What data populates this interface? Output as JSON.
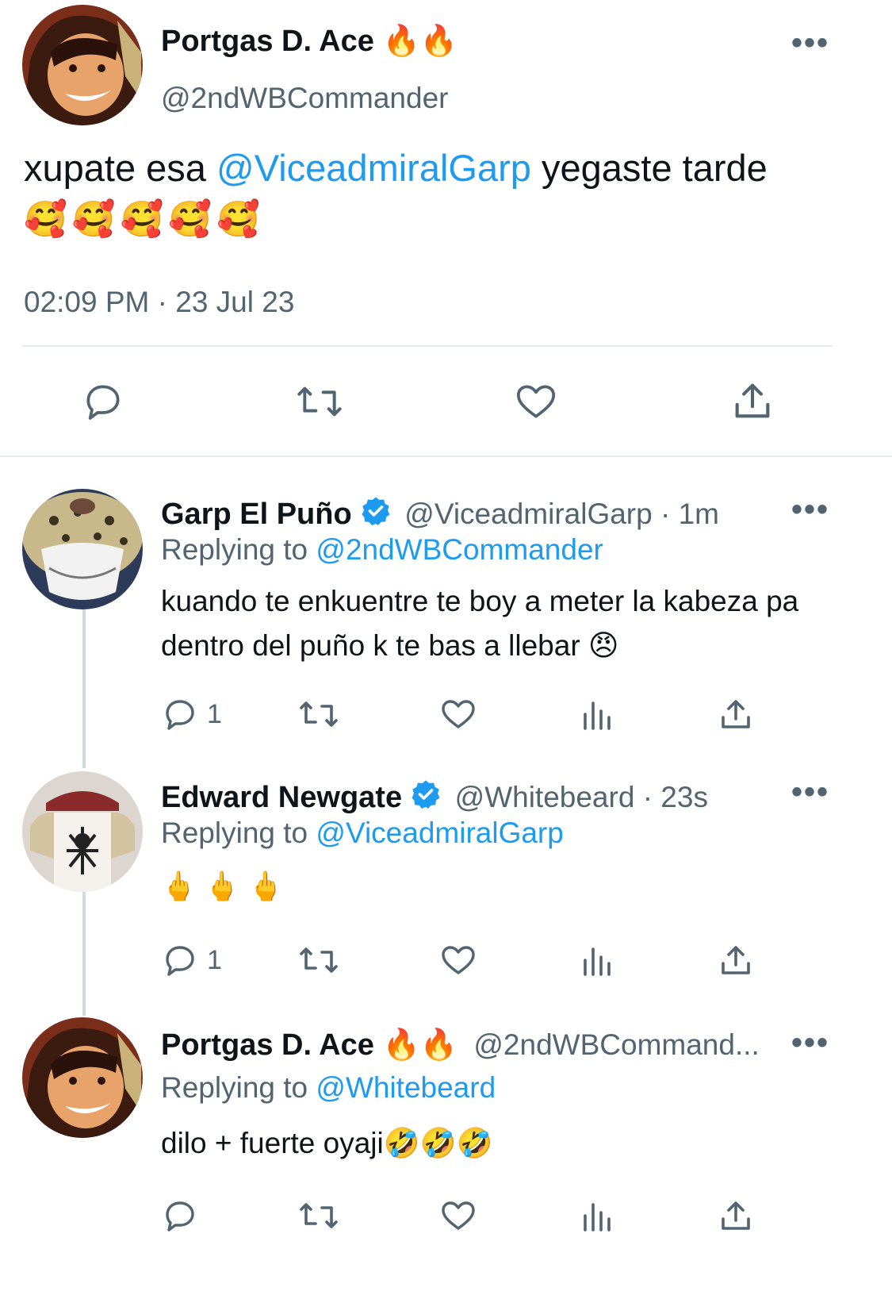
{
  "main_tweet": {
    "display_name": "Portgas D. Ace 🔥🔥",
    "handle": "@2ndWBCommander",
    "text_before": "xupate esa ",
    "mention": "@ViceadmiralGarp",
    "text_after": " yegaste tarde",
    "emojis": "🥰🥰🥰🥰🥰",
    "timestamp": "02:09 PM · 23 Jul 23"
  },
  "replies": [
    {
      "display_name": "Garp El Puño",
      "handle_time": "@ViceadmiralGarp · 1m",
      "replying_label": "Replying to ",
      "replying_to": "@2ndWBCommander",
      "text": "kuando te enkuentre te boy a meter la kabeza pa dentro del puño k te bas a llebar 😠",
      "reply_count": "1"
    },
    {
      "display_name": "Edward Newgate",
      "handle_time": "@Whitebeard · 23s",
      "replying_label": "Replying to ",
      "replying_to": "@ViceadmiralGarp",
      "text": "🖕🖕🖕",
      "reply_count": "1"
    },
    {
      "display_name": "Portgas D. Ace 🔥🔥",
      "handle_time": "@2ndWBCommand...",
      "replying_label": "Replying to ",
      "replying_to": "@Whitebeard",
      "text": "dilo + fuerte oyaji🤣🤣🤣",
      "reply_count": ""
    }
  ],
  "colors": {
    "accent": "#1d9bf0",
    "secondary_text": "#536471",
    "divider": "#e6ecf0"
  },
  "icons": {
    "more": "more-icon",
    "reply": "reply-icon",
    "retweet": "retweet-icon",
    "like": "like-icon",
    "views": "views-icon",
    "share": "share-icon",
    "verified": "verified-icon"
  }
}
